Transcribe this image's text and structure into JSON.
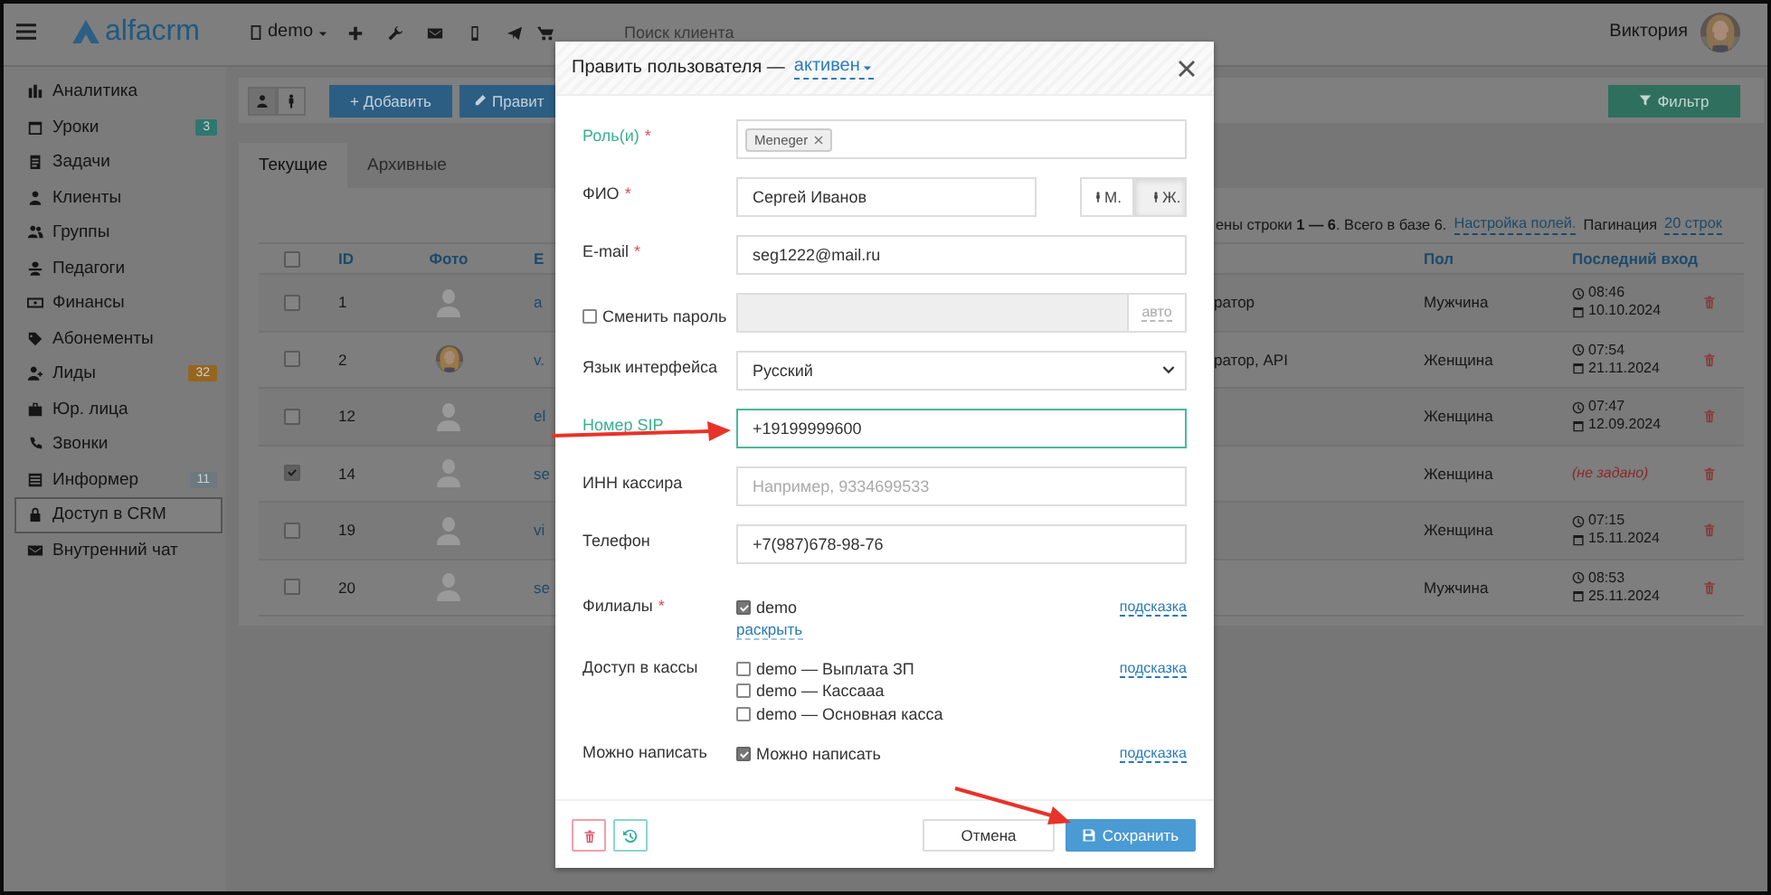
{
  "topbar": {
    "logo": "alfacrm",
    "branch": "demo",
    "search": {
      "placeholder": "Поиск клиента"
    },
    "user": "Виктория"
  },
  "sidebar": {
    "items": [
      {
        "label": "Аналитика",
        "selected": false
      },
      {
        "label": "Уроки",
        "selected": false,
        "badge": "3",
        "color": "#2f7670"
      },
      {
        "label": "Задачи",
        "selected": false
      },
      {
        "label": "Клиенты",
        "selected": false
      },
      {
        "label": "Группы",
        "selected": false
      },
      {
        "label": "Педагоги",
        "selected": false
      },
      {
        "label": "Финансы",
        "selected": false
      },
      {
        "label": "Абонементы",
        "selected": false
      },
      {
        "label": "Лиды",
        "selected": false,
        "badge": "32",
        "color": "#96651f"
      },
      {
        "label": "Юр. лица",
        "selected": false
      },
      {
        "label": "Звонки",
        "selected": false
      },
      {
        "label": "Информер",
        "selected": false,
        "badge": "11",
        "color": "#6e7880"
      },
      {
        "label": "Доступ в CRM",
        "selected": true
      },
      {
        "label": "Внутренний чат",
        "selected": false
      }
    ]
  },
  "toolbar": {
    "views": [
      {
        "selected": true
      },
      {
        "selected": false
      }
    ],
    "add": "+ Добавить",
    "edit": "Правит",
    "filter": "Фильтр"
  },
  "tabs": [
    {
      "label": "Текущие",
      "selected": true
    },
    {
      "label": "Архивные",
      "selected": false
    }
  ],
  "table": {
    "summary": "ены строки **1 — 6**. Всего в базе 6.",
    "settings_link": "Настройка полей.",
    "pagination_label": "Пагинация",
    "pagination_link": "20 строк",
    "all_checked": false,
    "columns": [
      "ID",
      "Фото",
      "E",
      "Пол",
      "Последний вход"
    ],
    "rows": [
      {
        "checked": false,
        "id": "1",
        "avatar": {
          "kind": "placeholder"
        },
        "email": "a",
        "role": "ратор",
        "gender": "Мужчина",
        "last_login": {
          "kind": "datetime",
          "time": "08:46",
          "date": "10.10.2024"
        }
      },
      {
        "checked": false,
        "id": "2",
        "email": "v.",
        "role": "ратор, API",
        "gender": "Женщина",
        "last_login": {
          "kind": "datetime",
          "time": "07:54",
          "date": "21.11.2024"
        }
      },
      {
        "checked": false,
        "id": "12",
        "avatar": {
          "kind": "placeholder"
        },
        "email": "el",
        "gender": "Женщина",
        "last_login": {
          "kind": "datetime",
          "time": "07:47",
          "date": "12.09.2024"
        }
      },
      {
        "checked": true,
        "id": "14",
        "avatar": {
          "kind": "placeholder"
        },
        "email": "se",
        "gender": "Женщина",
        "last_login": {
          "kind": "unset",
          "text": "(не задано)"
        }
      },
      {
        "checked": false,
        "id": "19",
        "avatar": {
          "kind": "placeholder"
        },
        "email": "vi",
        "gender": "Женщина",
        "last_login": {
          "kind": "datetime",
          "time": "07:15",
          "date": "15.11.2024"
        }
      },
      {
        "checked": false,
        "id": "20",
        "avatar": {
          "kind": "placeholder"
        },
        "email": "se",
        "gender": "Мужчина",
        "last_login": {
          "kind": "datetime",
          "time": "08:53",
          "date": "25.11.2024"
        }
      }
    ]
  },
  "modal": {
    "title": "Править пользователя —",
    "status": "активен",
    "fields": [
      {
        "kind": "tags",
        "label": "Роль(и)",
        "mark": "*",
        "highlighted": true,
        "focused": false,
        "tags": [
          "Meneger"
        ]
      },
      {
        "kind": "gender",
        "label": "ФИО",
        "mark": "*",
        "highlighted": false,
        "focused": false,
        "value": "Сергей Иванов",
        "options": [
          {
            "label": "М.",
            "selected": false
          },
          {
            "label": "Ж.",
            "selected": true
          }
        ]
      },
      {
        "kind": "text",
        "label": "E-mail",
        "mark": "*",
        "highlighted": false,
        "focused": false,
        "value": "seg1222@mail.ru"
      },
      {
        "kind": "password",
        "label": "Сменить пароль",
        "highlighted": false,
        "checked": false,
        "disabled": true,
        "addon": "авто"
      },
      {
        "kind": "select",
        "label": "Язык интерфейса",
        "highlighted": false,
        "focused": false,
        "value": "Русский"
      },
      {
        "kind": "text",
        "label": "Номер SIP",
        "highlighted": true,
        "focused": true,
        "value": "+19199999600"
      },
      {
        "kind": "text",
        "label": "ИНН кассира",
        "highlighted": false,
        "focused": false,
        "placeholder": "Например, 9334699533"
      },
      {
        "kind": "text",
        "label": "Телефон",
        "highlighted": false,
        "focused": false,
        "value": "+7(987)678-98-76"
      },
      {
        "kind": "checkboxes",
        "label": "Филиалы",
        "mark": "*",
        "highlighted": false,
        "options": [
          {
            "label": "demo",
            "checked": true
          }
        ],
        "link": "раскрыть",
        "hint": "подсказка"
      },
      {
        "kind": "checkboxes",
        "label": "Доступ в кассы",
        "highlighted": false,
        "options": [
          {
            "label": "demo — Выплата ЗП",
            "checked": false
          },
          {
            "label": "demo — Кассааа",
            "checked": false
          },
          {
            "label": "demo — Основная касса",
            "checked": false
          }
        ],
        "hint": "подсказка"
      },
      {
        "kind": "checkboxes",
        "label": "Можно написать",
        "highlighted": false,
        "options": [
          {
            "label": "Можно написать",
            "checked": true
          }
        ],
        "hint": "подсказка"
      }
    ],
    "footer": {
      "cancel": "Отмена",
      "save": "Сохранить"
    }
  }
}
